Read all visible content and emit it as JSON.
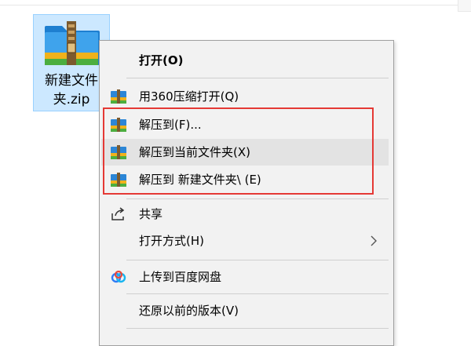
{
  "desktop": {
    "file": {
      "name": "新建文件夹.zip",
      "icon": "zip-archive-icon"
    }
  },
  "context_menu": {
    "items": [
      {
        "label": "打开(O)",
        "icon": null,
        "bold": true
      },
      {
        "label": "用360压缩打开(Q)",
        "icon": "360zip-icon"
      },
      {
        "label": "解压到(F)...",
        "icon": "360zip-icon"
      },
      {
        "label": "解压到当前文件夹(X)",
        "icon": "360zip-icon",
        "highlighted": true
      },
      {
        "label": "解压到 新建文件夹\\ (E)",
        "icon": "360zip-icon"
      },
      {
        "label": "共享",
        "icon": "share-icon"
      },
      {
        "label": "打开方式(H)",
        "icon": null,
        "submenu": true
      },
      {
        "label": "上传到百度网盘",
        "icon": "baidu-netdisk-icon"
      },
      {
        "label": "还原以前的版本(V)",
        "icon": null
      }
    ]
  },
  "colors": {
    "highlight_box": "#e53935",
    "selection_bg": "#cce8ff",
    "menu_bg": "#f2f2f2"
  }
}
